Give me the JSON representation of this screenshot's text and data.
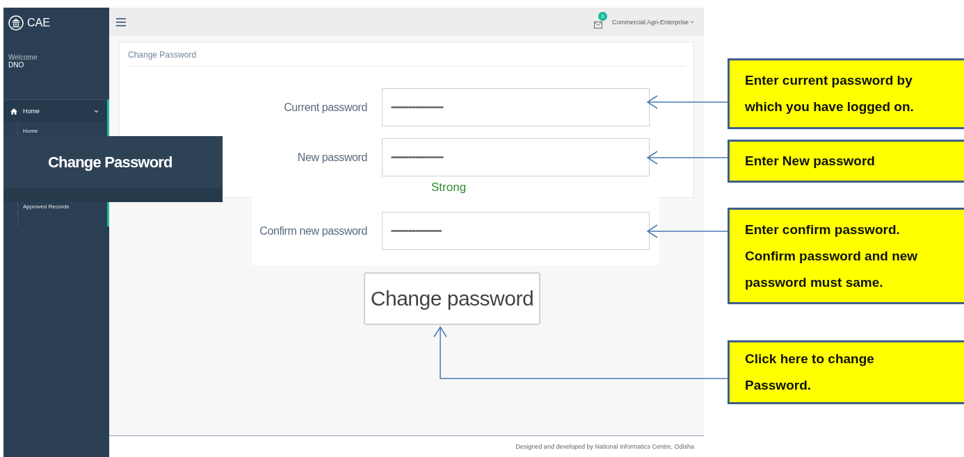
{
  "sidebar": {
    "logo": "CAE",
    "welcome": "Welcome",
    "user": "DNO",
    "menu": [
      {
        "label": "Home",
        "selected": true,
        "expanded": true,
        "children": [
          {
            "label": "Home"
          },
          {
            "label": "Approved Records"
          }
        ]
      }
    ]
  },
  "topbar": {
    "badge": "0",
    "account": "Commercial Agri-Enterprise"
  },
  "card": {
    "title": "Change Password"
  },
  "footer": "Designed and developed by National Informatics Centre, Odisha",
  "inset": {
    "menu_item": "Change Password"
  },
  "form": {
    "fields": [
      {
        "label": "Current password",
        "value": "••••••••••••••••••••••••••••••"
      },
      {
        "label": "New password",
        "value": "••••••••••••••••••••••••••••••",
        "strength": "Strong"
      },
      {
        "label": "Confirm new password",
        "value": "•••••••••••••••••••••••••••••"
      }
    ],
    "button": "Change password"
  },
  "callouts": [
    {
      "texts": [
        "Enter current password by which you have logged on."
      ]
    },
    {
      "texts": [
        "Enter New password"
      ]
    },
    {
      "texts": [
        "Enter confirm password.",
        "Confirm password and new password must same."
      ]
    },
    {
      "texts": [
        "Click here to change Password."
      ]
    }
  ]
}
